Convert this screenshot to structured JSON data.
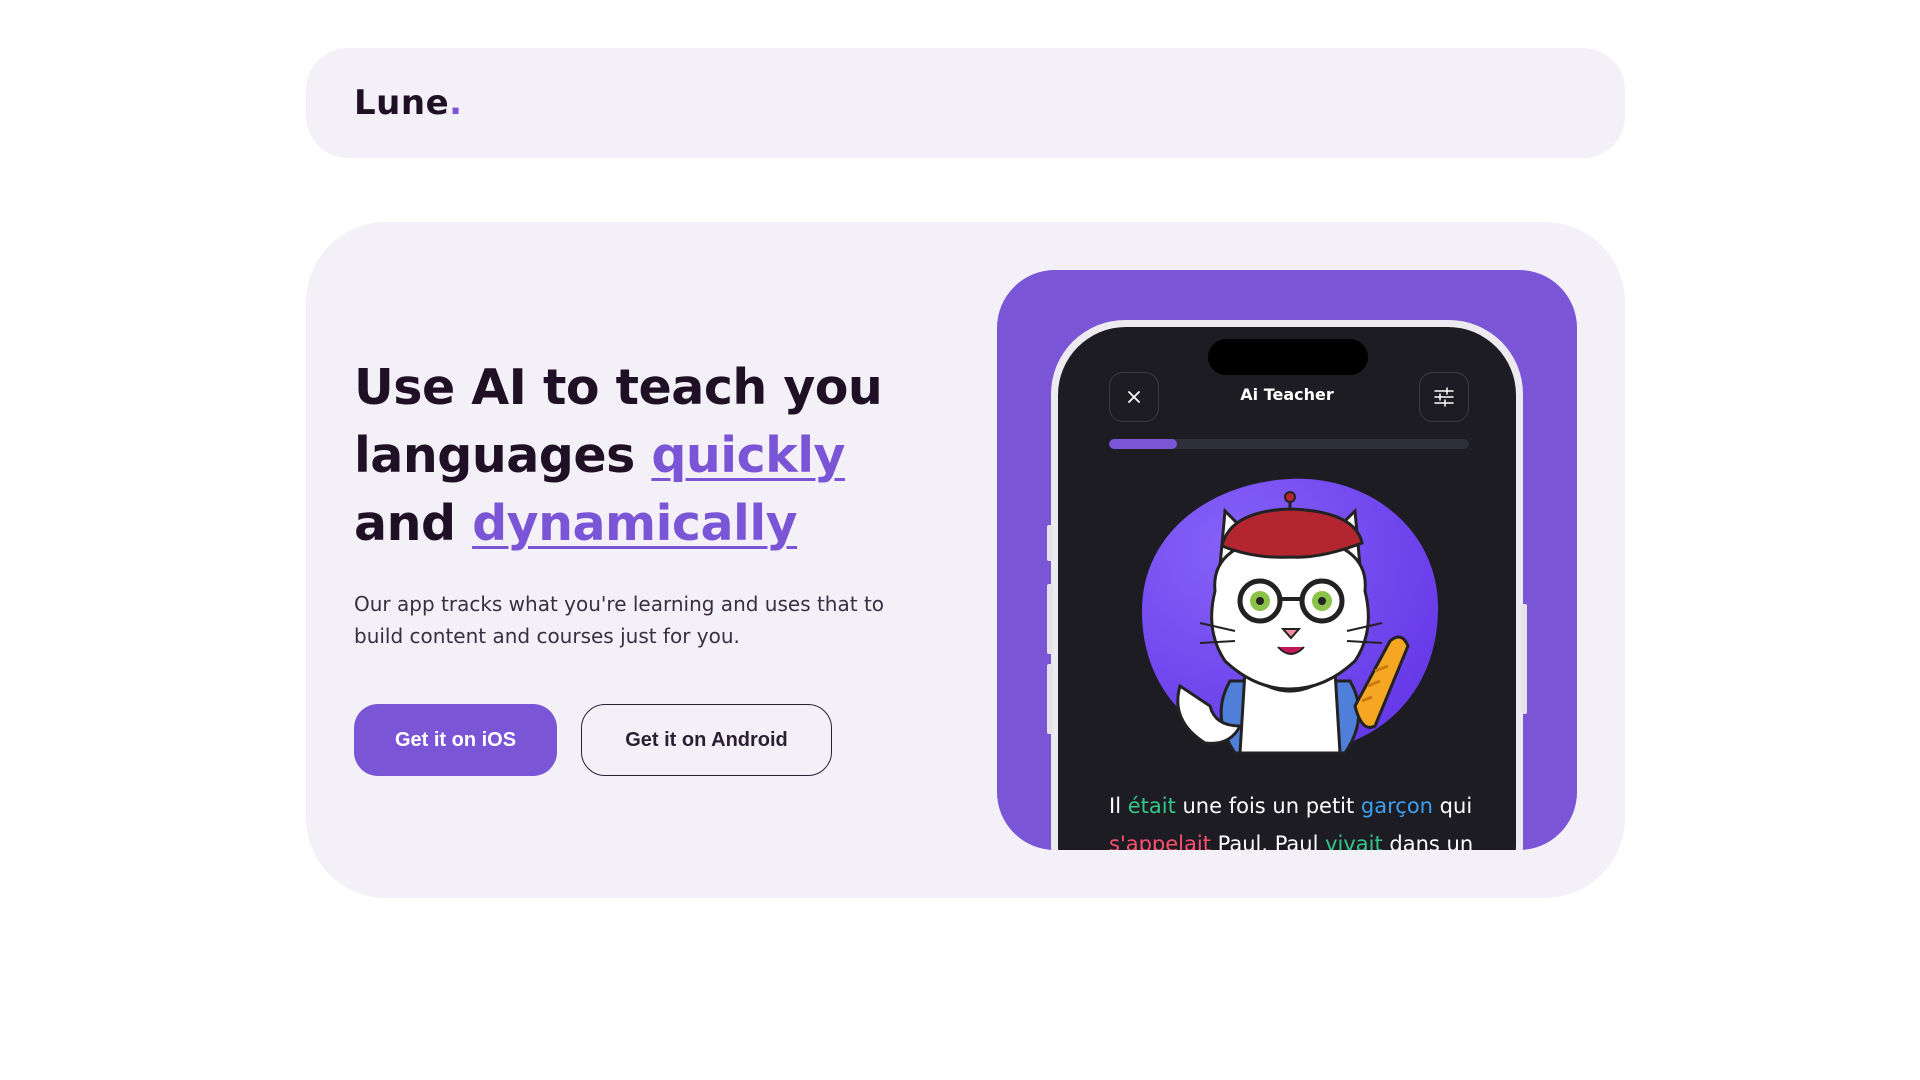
{
  "brand": {
    "name": "Lune",
    "dot": "."
  },
  "hero": {
    "headline": {
      "line1": "Use AI to teach you",
      "line2_plain": "languages ",
      "line2_accent": "quickly",
      "line3_plain": "and ",
      "line3_accent": "dynamically"
    },
    "subtext": "Our app tracks what you're learning and uses that to build content and courses just for you.",
    "buttons": {
      "ios": "Get it on iOS",
      "android": "Get it on Android"
    }
  },
  "phone": {
    "title": "Ai Teacher",
    "close_icon": "close-icon",
    "settings_icon": "sliders-icon",
    "progress": 0.19,
    "story_words": [
      "Il",
      " ",
      "était",
      " une fois un petit ",
      "garçon",
      " qui",
      "s'appelait",
      " Paul. Paul ",
      "vivait",
      " dans un"
    ]
  },
  "colors": {
    "accent": "#7a55d6",
    "panel": "#f3f0f8",
    "text_dark": "#1f1026",
    "word_green": "#34c58a",
    "word_blue": "#3aa0f0",
    "word_red": "#ff4f70"
  }
}
